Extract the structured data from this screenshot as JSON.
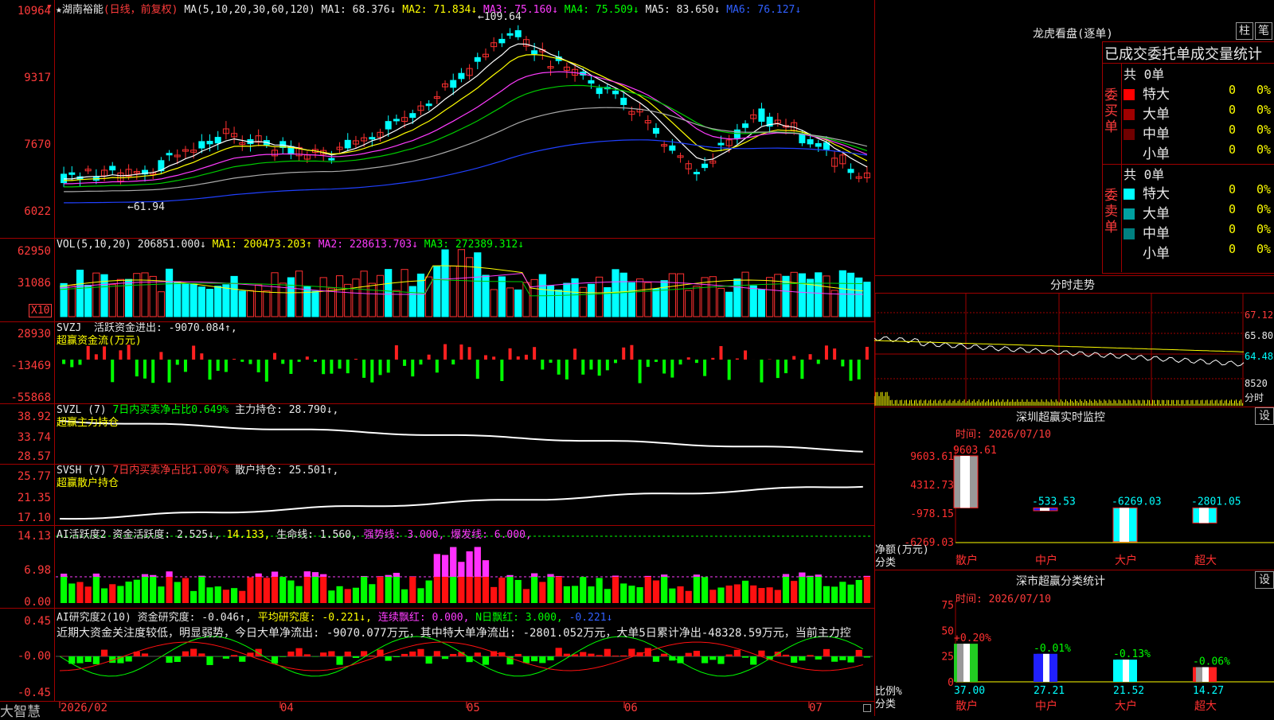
{
  "stock": {
    "star": "★",
    "name": "湖南裕能",
    "mode": "(日线，前复权)",
    "ma_params": "MA(5,10,20,30,60,120)",
    "ma1": "MA1: 68.376↓",
    "ma2": "MA2: 71.834↓",
    "ma3": "MA3: 75.160↓",
    "ma4": "MA4: 75.509↓",
    "ma5": "MA5: 83.650↓",
    "ma6": "MA6: 76.127↓",
    "high_label": "109.64",
    "low_label": "←61.94",
    "y_labels": [
      "10964",
      "9317",
      "7670",
      "6022"
    ]
  },
  "vol": {
    "title": "VOL(5,10,20)",
    "val": "206851.000↓",
    "ma1": "MA1: 200473.203↑",
    "ma2": "MA2: 228613.703↓",
    "ma3": "MA3: 272389.312↓",
    "y_labels": [
      "62950",
      "31086"
    ],
    "unit": "X10"
  },
  "svzj": {
    "title": "SVZJ",
    "line1": "活跃资金进出: -9070.084↑,",
    "line2": "超赢资金流(万元)",
    "y_labels": [
      "28930",
      "-13469",
      "-55868"
    ]
  },
  "svzl": {
    "title": "SVZL (7)",
    "seg1": "7日内买卖净占比0.649%",
    "seg2": "主力持仓: 28.790↓,",
    "line2": "超赢主力持仓",
    "y_labels": [
      "38.92",
      "33.74",
      "28.57"
    ]
  },
  "svsh": {
    "title": "SVSH (7)",
    "seg1": "7日内买卖净占比1.007%",
    "seg2": "散户持仓: 25.501↑,",
    "line2": "超赢散户持仓",
    "y_labels": [
      "25.77",
      "21.35",
      "17.10"
    ]
  },
  "ai1": {
    "title": "AI活跃度2",
    "seg1": "资金活跃度: 2.525↓,",
    "seg2": "14.133,",
    "seg3": "生命线: 1.560,",
    "seg4": "强势线: 3.000,",
    "seg5": "爆发线: 6.000,",
    "y_labels": [
      "14.13",
      "6.98",
      "0.00"
    ]
  },
  "ai2": {
    "title": "AI研究度2(10)",
    "seg1": "资金研究度: -0.046↑,",
    "seg2": "平均研究度: -0.221↓,",
    "seg3": "连续飘红: 0.000,",
    "seg4": "N日飘红: 3.000,",
    "seg5": "-0.221↓",
    "comment": "近期大资金关注度较低，明显弱势，今日大单净流出: -9070.077万元，其中特大单净流出: -2801.052万元，大单5日累计净出-48328.59万元，当前主力控",
    "y_labels": [
      "0.45",
      "-0.00",
      "-0.45"
    ]
  },
  "xaxis": {
    "brand": "大智慧",
    "labels": [
      "2026/02",
      "04",
      "05",
      "06",
      "07"
    ]
  },
  "right": {
    "dragon_title": "龙虎看盘(逐单)",
    "btn_bar": "柱",
    "btn_pen": "笔",
    "table_title": "已成交委托单成交量统计",
    "buy_count": "共 0单",
    "buy_label": "委买单",
    "sell_count": "共 0单",
    "sell_label": "委卖单",
    "buy_rows": [
      {
        "name": "特大",
        "qty": "0",
        "pct": "0%",
        "color": "#ff0000"
      },
      {
        "name": "大单",
        "qty": "0",
        "pct": "0%",
        "color": "#a00000"
      },
      {
        "name": "中单",
        "qty": "0",
        "pct": "0%",
        "color": "#700000"
      },
      {
        "name": "小单",
        "qty": "0",
        "pct": "0%",
        "color": "#000000"
      }
    ],
    "sell_rows": [
      {
        "name": "特大",
        "qty": "0",
        "pct": "0%",
        "color": "#00ffff"
      },
      {
        "name": "大单",
        "qty": "0",
        "pct": "0%",
        "color": "#00a0a0"
      },
      {
        "name": "中单",
        "qty": "0",
        "pct": "0%",
        "color": "#008080"
      },
      {
        "name": "小单",
        "qty": "0",
        "pct": "0%",
        "color": "#000000"
      }
    ],
    "intraday_title": "分时走势",
    "intraday_labels": [
      "67.12",
      "65.80",
      "64.48",
      "8520"
    ],
    "intraday_unit": "分时",
    "monitor_title": "深圳超赢实时监控",
    "monitor_btn": "设",
    "monitor_time": "时间: 2026/07/10",
    "monitor_y": [
      "9603.61",
      "4312.73",
      "-978.15",
      "-6269.03"
    ],
    "monitor_ylabel1": "净额(万元)",
    "monitor_ylabel2": "分类",
    "monitor_bars": [
      {
        "cat": "散户",
        "value": 9603.61,
        "label": "9603.61"
      },
      {
        "cat": "中户",
        "value": -533.53,
        "label": "-533.53"
      },
      {
        "cat": "大户",
        "value": -6269.03,
        "label": "-6269.03"
      },
      {
        "cat": "超大",
        "value": -2801.05,
        "label": "-2801.05"
      }
    ],
    "class_title": "深市超赢分类统计",
    "class_btn": "设",
    "class_time": "时间: 2026/07/10",
    "class_y": [
      "75",
      "50",
      "25",
      "0"
    ],
    "class_ylabel1": "比例%",
    "class_ylabel2": "分类",
    "class_bars": [
      {
        "cat": "散户",
        "value": 37.0,
        "label": "37.00",
        "change": "+0.20%"
      },
      {
        "cat": "中户",
        "value": 27.21,
        "label": "27.21",
        "change": "-0.01%"
      },
      {
        "cat": "大户",
        "value": 21.52,
        "label": "21.52",
        "change": "-0.13%"
      },
      {
        "cat": "超大",
        "value": 14.27,
        "label": "14.27",
        "change": "-0.06%"
      }
    ]
  }
}
